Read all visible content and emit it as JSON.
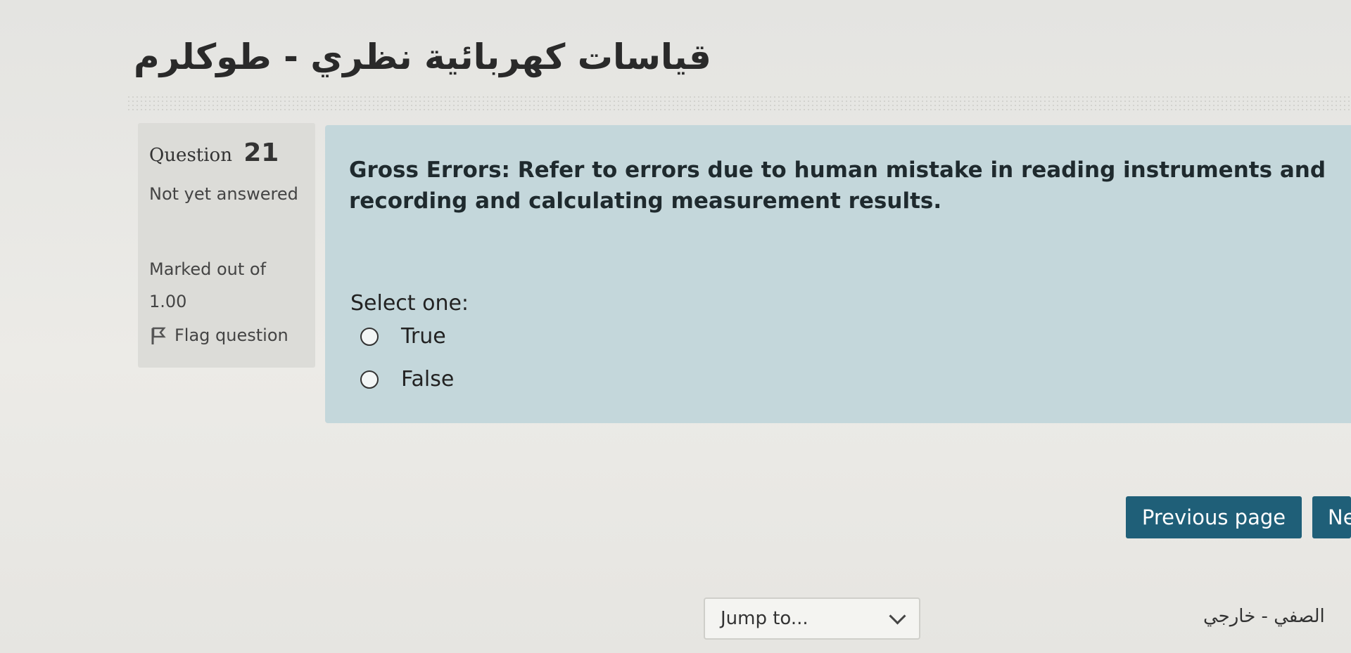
{
  "course": {
    "title": "قياسات كهربائية نظري - طوكلرم"
  },
  "info": {
    "question_label": "Question",
    "question_number": "21",
    "state": "Not yet answered",
    "grade": "Marked out of 1.00",
    "flag_label": "Flag question"
  },
  "question": {
    "text": "Gross Errors: Refer to errors due to human mistake in reading instruments and recording and calculating measurement results.",
    "prompt": "Select one:",
    "options": [
      {
        "label": "True"
      },
      {
        "label": "False"
      }
    ]
  },
  "nav": {
    "previous_label": "Previous page",
    "next_label": "Ne",
    "jump_label": "Jump to...",
    "next_activity": "الصفي - خارجي"
  },
  "icons": {
    "flag": "flag-icon",
    "radio": "radio-icon",
    "jump_dropdown": "chevron-down-icon"
  },
  "colors": {
    "question_bg": "#c4d7db",
    "info_bg": "#dcdcd8",
    "button": "#1f5f78"
  }
}
